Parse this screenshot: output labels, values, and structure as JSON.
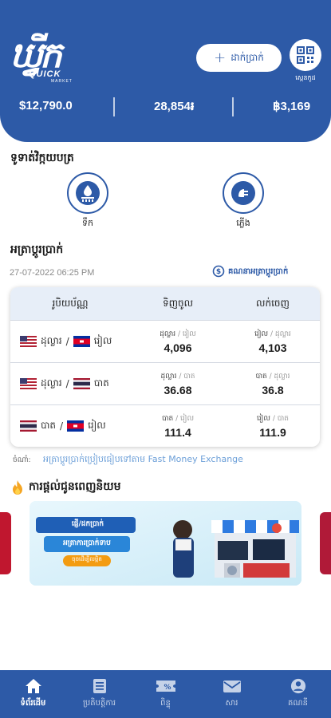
{
  "colors": {
    "brand": "#2d5aa7",
    "accent_link": "#6c9fd8"
  },
  "header": {
    "logo_main": "ឃ្វីក",
    "logo_sub1": "QUICK",
    "logo_sub2": "MARKET",
    "deposit_label": "ដាក់ប្រាក់",
    "qr_label": "ស្កេនកូដ",
    "balances": {
      "usd": "$12,790.0",
      "khr": "28,854៛",
      "thb": "฿3,169"
    }
  },
  "bills": {
    "title": "ទូទាត់វិក្កយបត្រ",
    "items": [
      {
        "label": "ទឹក",
        "icon": "water-icon"
      },
      {
        "label": "ភ្លើង",
        "icon": "electricity-icon"
      }
    ]
  },
  "exchange": {
    "title": "អត្រាប្តូរប្រាក់",
    "datetime": "27-07-2022 06:25 PM",
    "calc_link": "គណនាអត្រាប្តូរប្រាក់",
    "headers": {
      "currency": "រូបិយប័ណ្ណ",
      "buy": "ទិញចូល",
      "sell": "លក់ចេញ"
    },
    "rows": [
      {
        "left": "ដុល្លារ",
        "right": "រៀល",
        "buy_unit_a": "ដុល្លារ",
        "buy_unit_b": "រៀល",
        "buy": "4,096",
        "sell_unit_a": "រៀល",
        "sell_unit_b": "ដុល្លារ",
        "sell": "4,103",
        "flag_a": "us",
        "flag_b": "kh"
      },
      {
        "left": "ដុល្លារ",
        "right": "បាត",
        "buy_unit_a": "ដុល្លារ",
        "buy_unit_b": "បាត",
        "buy": "36.68",
        "sell_unit_a": "បាត",
        "sell_unit_b": "ដុល្លារ",
        "sell": "36.8",
        "flag_a": "us",
        "flag_b": "th"
      },
      {
        "left": "បាត",
        "right": "រៀល",
        "buy_unit_a": "បាត",
        "buy_unit_b": "រៀល",
        "buy": "111.4",
        "sell_unit_a": "រៀល",
        "sell_unit_b": "បាត",
        "sell": "111.9",
        "flag_a": "th",
        "flag_b": "kh"
      }
    ],
    "source_label": "ចំណាំ:",
    "source_text": "អត្រាប្តូរប្រាក់ប្រៀបធៀបទៅតាម Fast Money Exchange"
  },
  "promo": {
    "title": "ការផ្តល់ជូនពេញនិយម",
    "banner_line1": "ផ្ញើ/ដកប្រាក់",
    "banner_line2": "អត្រាការប្រាក់ទាប",
    "banner_cta": "ចុចដើម្បីលម្អិត"
  },
  "tabs": [
    {
      "label": "ទំព័រដើម",
      "icon": "home-icon",
      "active": true
    },
    {
      "label": "ប្រតិបត្តិការ",
      "icon": "document-icon",
      "active": false
    },
    {
      "label": "ពិន្ទុ",
      "icon": "coupon-icon",
      "active": false
    },
    {
      "label": "សារ",
      "icon": "mail-icon",
      "active": false
    },
    {
      "label": "គណនី",
      "icon": "account-icon",
      "active": false
    }
  ]
}
